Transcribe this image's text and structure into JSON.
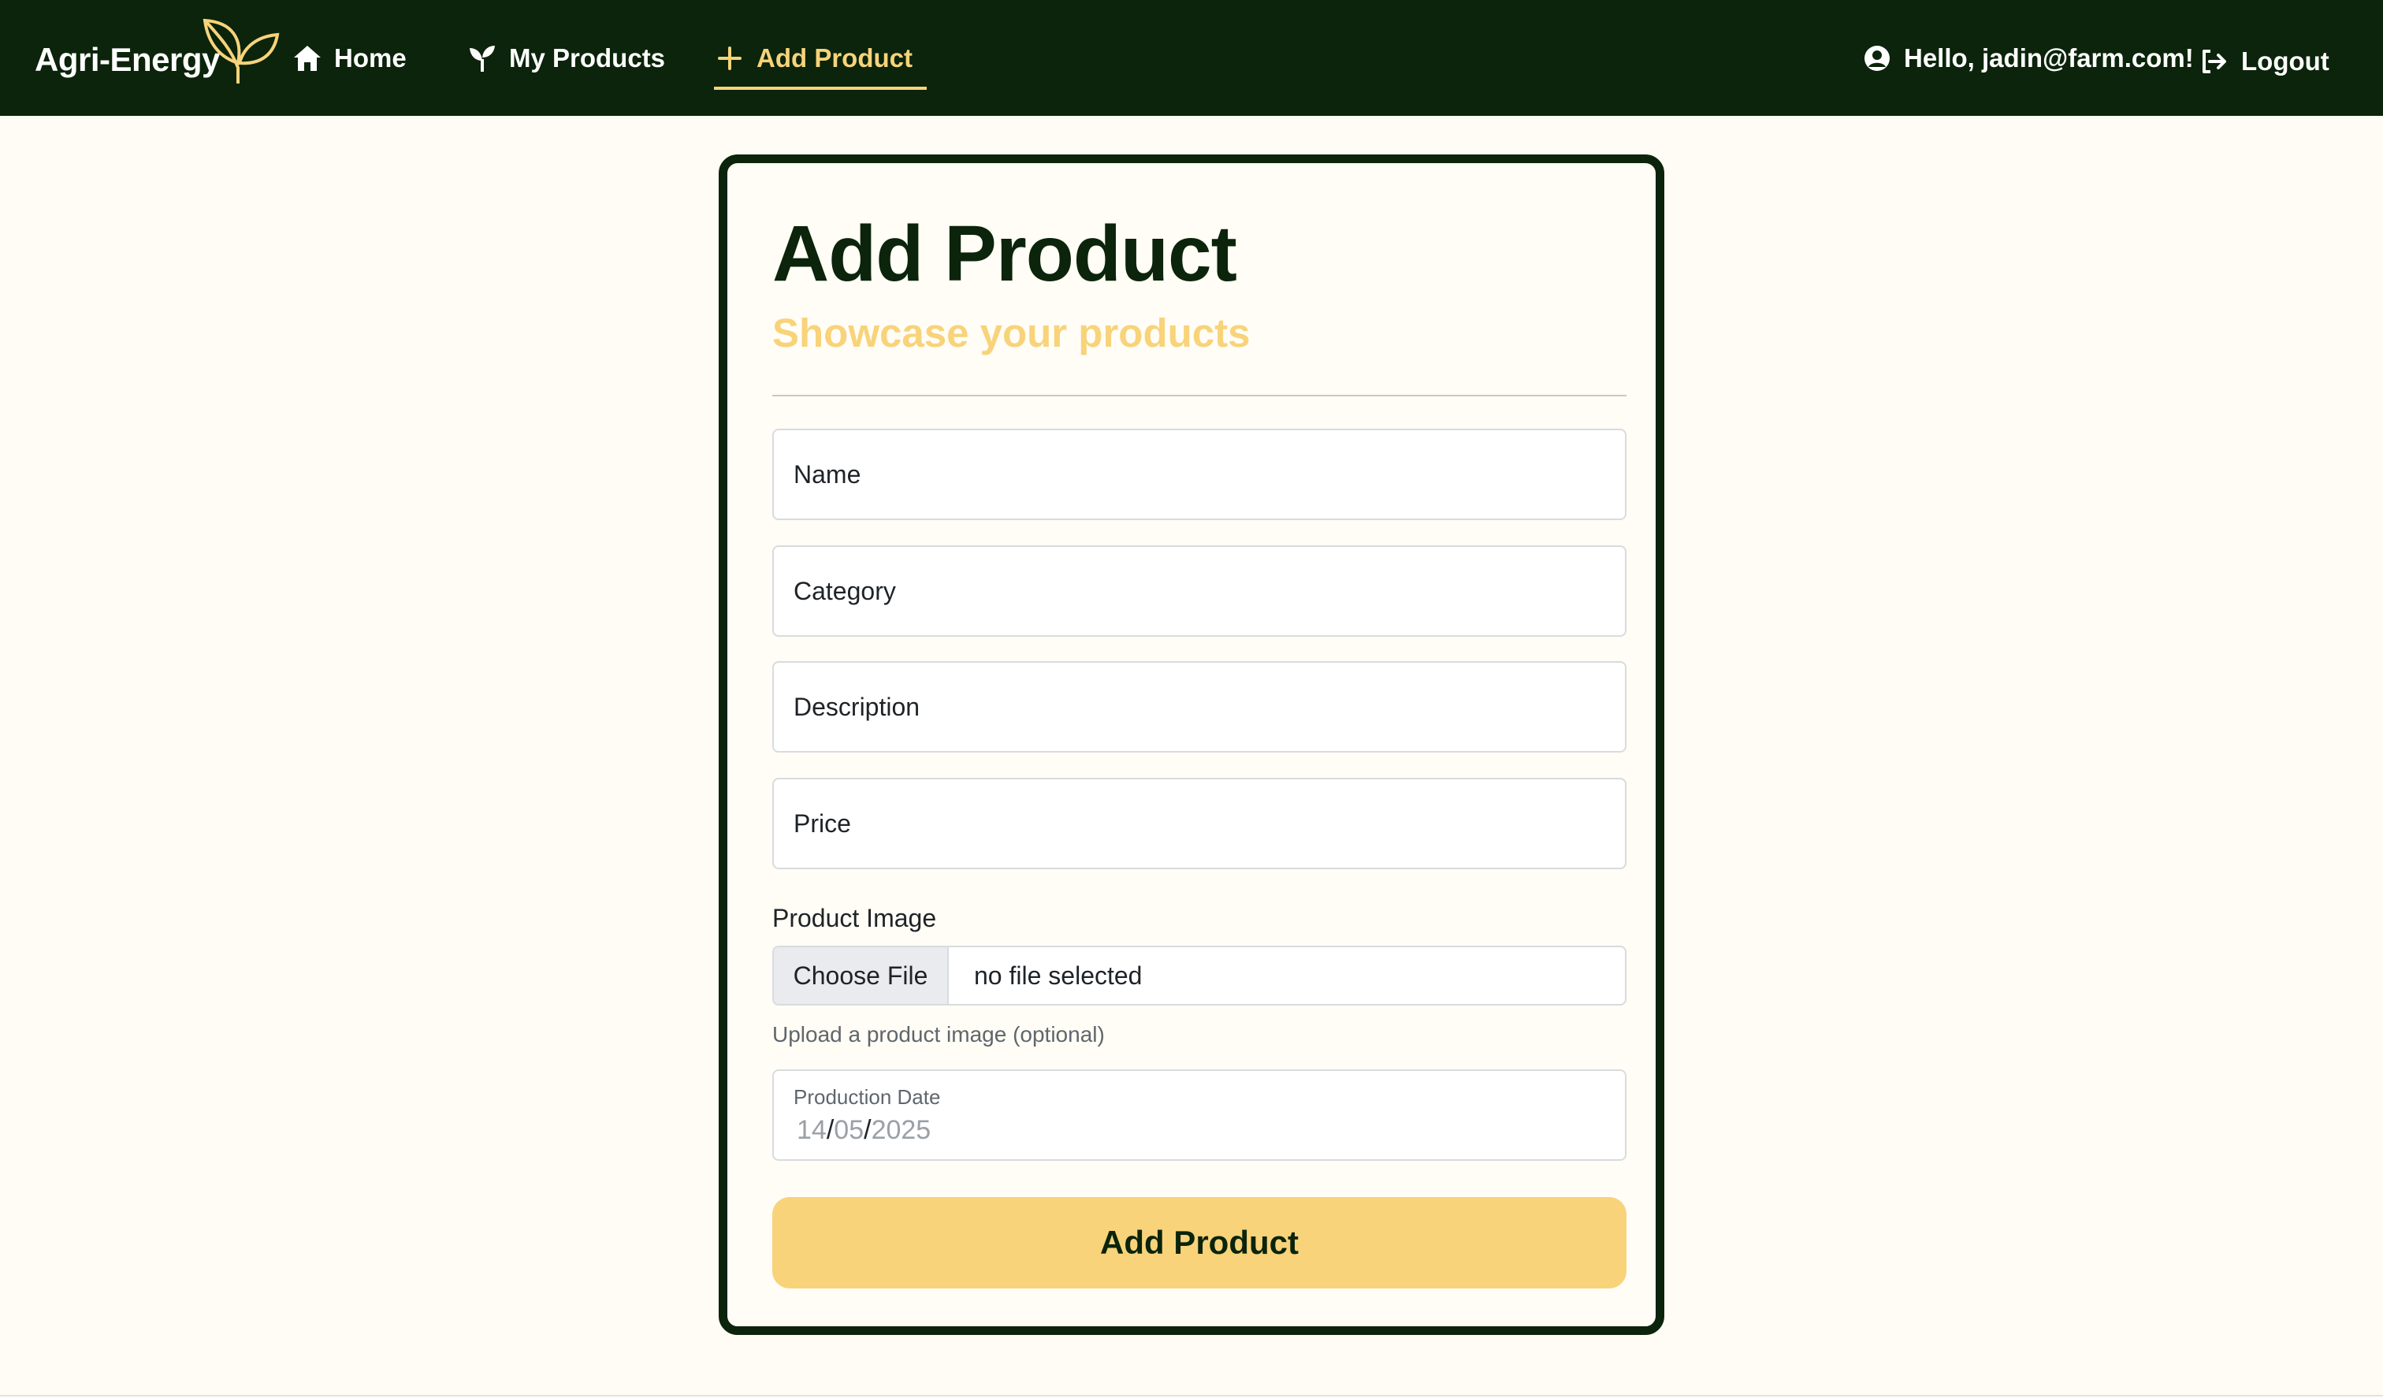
{
  "nav": {
    "brand": "Agri-Energy",
    "home": "Home",
    "my_products": "My Products",
    "add_product": "Add Product",
    "greeting": "Hello, jadin@farm.com!",
    "logout": "Logout"
  },
  "card": {
    "title": "Add Product",
    "subtitle": "Showcase your products"
  },
  "form": {
    "name_placeholder": "Name",
    "category_placeholder": "Category",
    "description_placeholder": "Description",
    "price_placeholder": "Price",
    "image_label": "Product Image",
    "choose_file": "Choose File",
    "file_status": "no file selected",
    "image_help": "Upload a product image (optional)",
    "date_label": "Production Date",
    "date_day": "14",
    "date_month": "05",
    "date_year": "2025",
    "submit": "Add Product"
  },
  "colors": {
    "nav_bg": "#0b240b",
    "accent": "#f8d37a",
    "page_bg": "#fefcf4"
  },
  "icons": {
    "brand": "leaf-icon",
    "home": "home-icon",
    "my_products": "sprout-icon",
    "add_product": "plus-icon",
    "user": "user-circle-icon",
    "logout": "logout-icon"
  }
}
